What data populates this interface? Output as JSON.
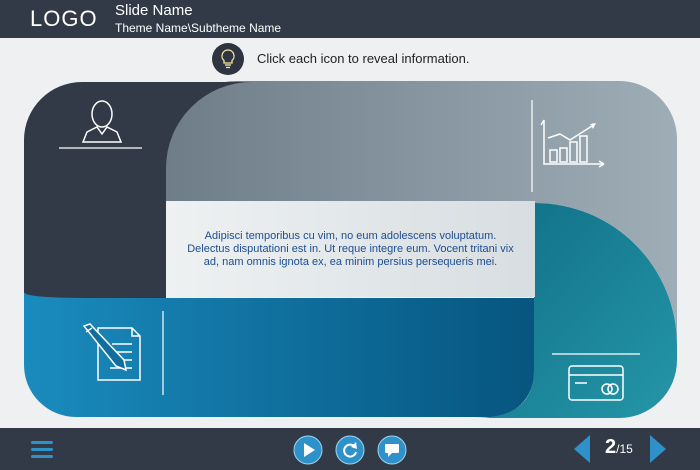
{
  "header": {
    "logo": "LOGO",
    "slide_name": "Slide Name",
    "theme_name": "Theme Name\\Subtheme Name"
  },
  "instruction": {
    "icon": "lightbulb-icon",
    "text": "Click each icon to reveal information."
  },
  "content": {
    "text": "Adipisci temporibus cu vim, no eum adolescens voluptatum. Delectus disputationi est in. Ut reque integre eum. Vocent tritani vix ad, nam omnis ignota ex, ea minim persius persequeris mei."
  },
  "hotspots": [
    {
      "icon": "person-icon"
    },
    {
      "icon": "growth-chart-icon"
    },
    {
      "icon": "document-pencil-icon"
    },
    {
      "icon": "credit-card-icon"
    }
  ],
  "footer": {
    "menu_icon": "menu-icon",
    "play_icon": "play-icon",
    "replay_icon": "replay-icon",
    "chat_icon": "chat-icon",
    "prev_icon": "prev-arrow-icon",
    "next_icon": "next-arrow-icon",
    "page_current": "2",
    "page_total": "/15"
  },
  "colors": {
    "dark": "#323a47",
    "gray": "#8a98a2",
    "teal": "#1a8899",
    "blue": "#0b72a5",
    "accent": "#2f91c9"
  }
}
